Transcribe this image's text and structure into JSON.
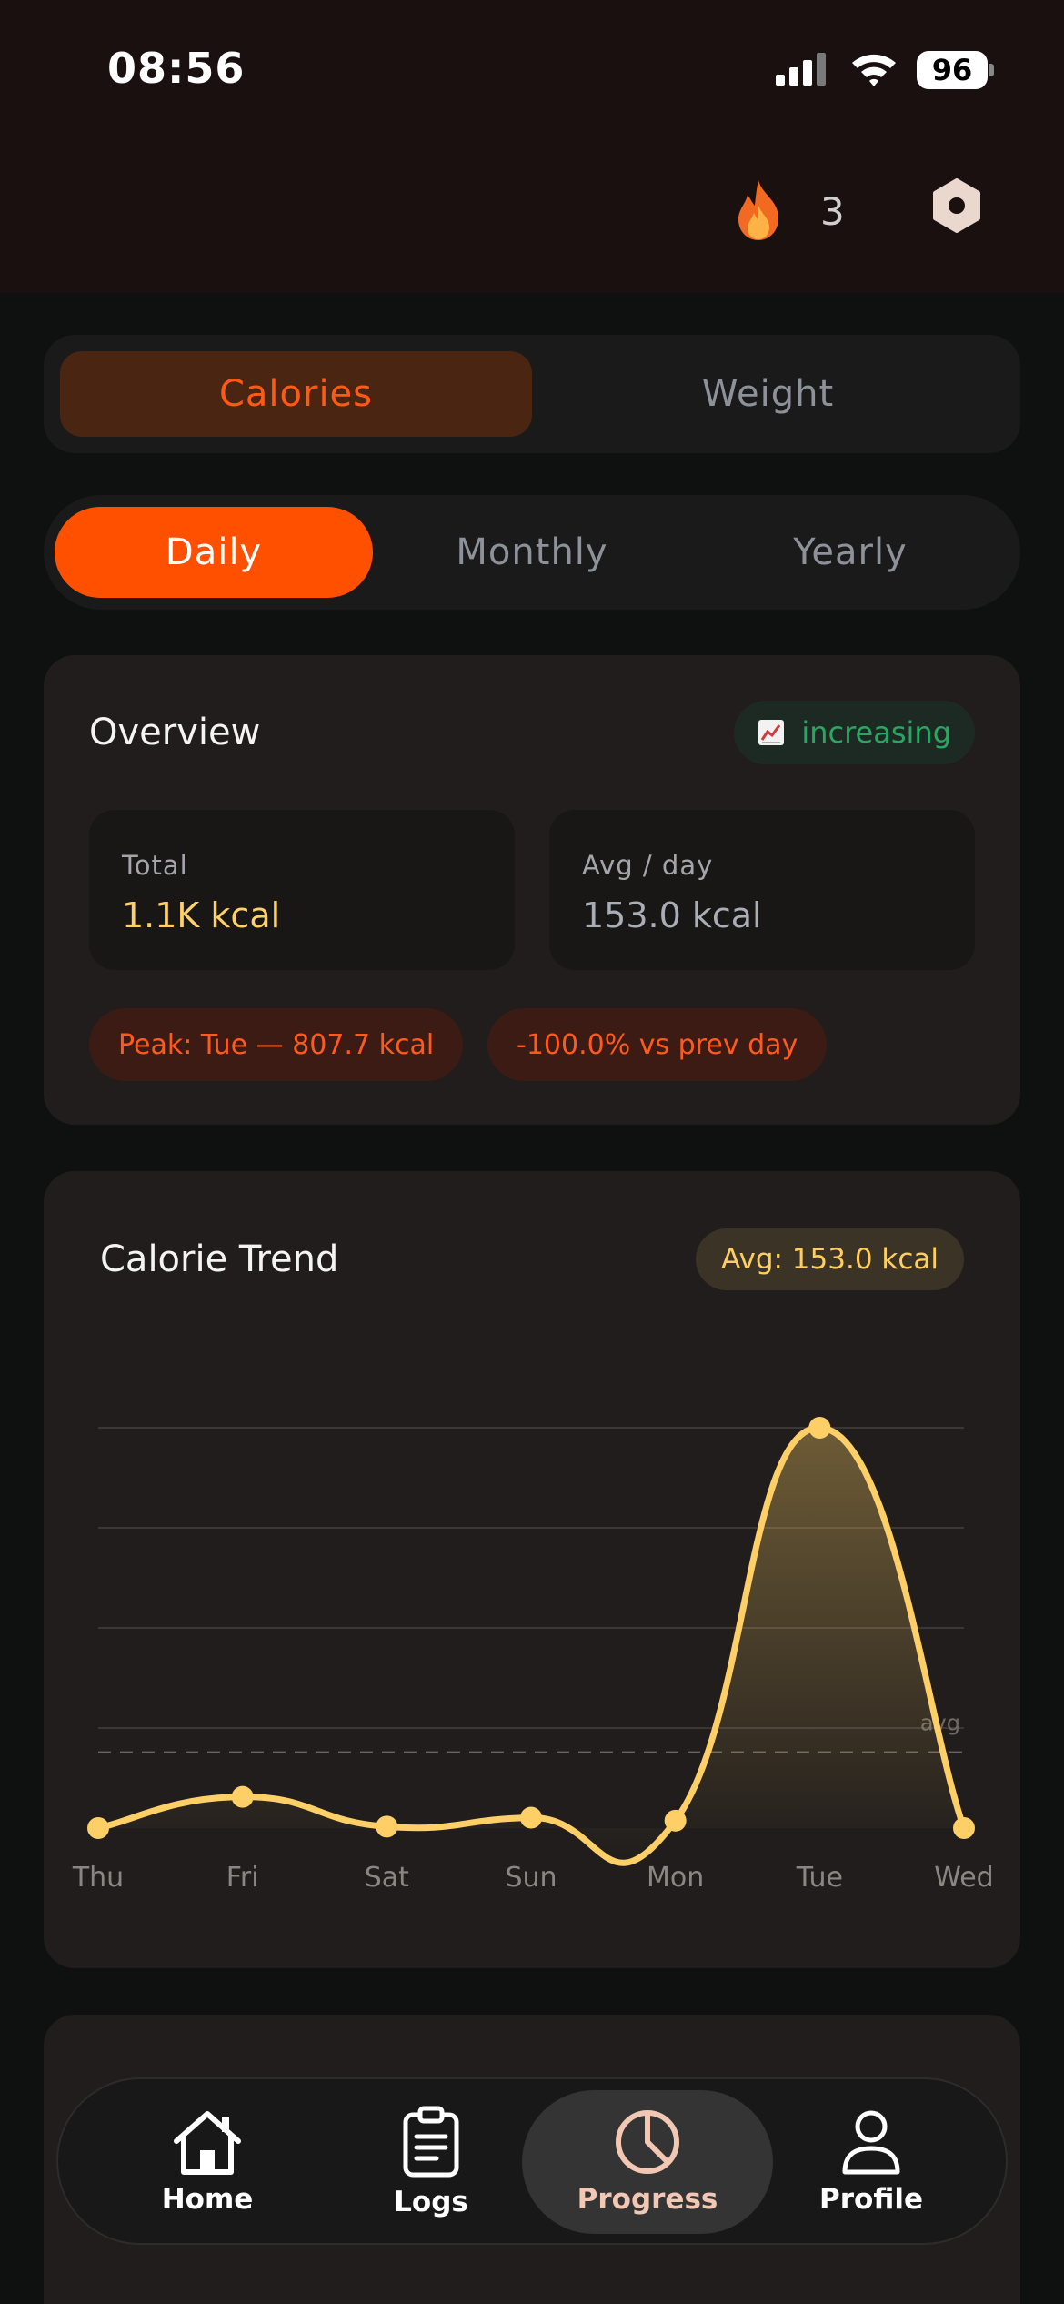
{
  "status_bar": {
    "time": "08:56",
    "battery": "96"
  },
  "header": {
    "streak_count": "3"
  },
  "metric_tabs": [
    {
      "label": "Calories",
      "active": true
    },
    {
      "label": "Weight",
      "active": false
    }
  ],
  "period_tabs": [
    {
      "label": "Daily",
      "active": true
    },
    {
      "label": "Monthly",
      "active": false
    },
    {
      "label": "Yearly",
      "active": false
    }
  ],
  "overview": {
    "title": "Overview",
    "trend_label": "increasing",
    "total_label": "Total",
    "total_value": "1.1K kcal",
    "avg_label": "Avg / day",
    "avg_value": "153.0 kcal",
    "peak_chip": "Peak: Tue — 807.7 kcal",
    "change_chip": "-100.0% vs prev day"
  },
  "trend_card": {
    "title": "Calorie Trend",
    "avg_badge": "Avg: 153.0 kcal"
  },
  "chart_data": {
    "type": "area",
    "categories": [
      "Thu",
      "Fri",
      "Sat",
      "Sun",
      "Mon",
      "Tue",
      "Wed"
    ],
    "values": [
      0,
      63,
      3,
      21,
      15,
      807.7,
      0
    ],
    "average": 153.0,
    "average_label": "avg",
    "ylim": [
      0,
      807.7
    ],
    "grid": true,
    "color": "#ffcf67"
  },
  "nav": [
    {
      "label": "Home",
      "icon": "home-icon",
      "active": false
    },
    {
      "label": "Logs",
      "icon": "clipboard-icon",
      "active": false
    },
    {
      "label": "Progress",
      "icon": "pie-chart-icon",
      "active": true
    },
    {
      "label": "Profile",
      "icon": "person-icon",
      "active": false
    }
  ],
  "colors": {
    "accent": "#ff5000",
    "gold": "#ffcf67",
    "success": "#2aa562",
    "background": "#0f1010"
  }
}
